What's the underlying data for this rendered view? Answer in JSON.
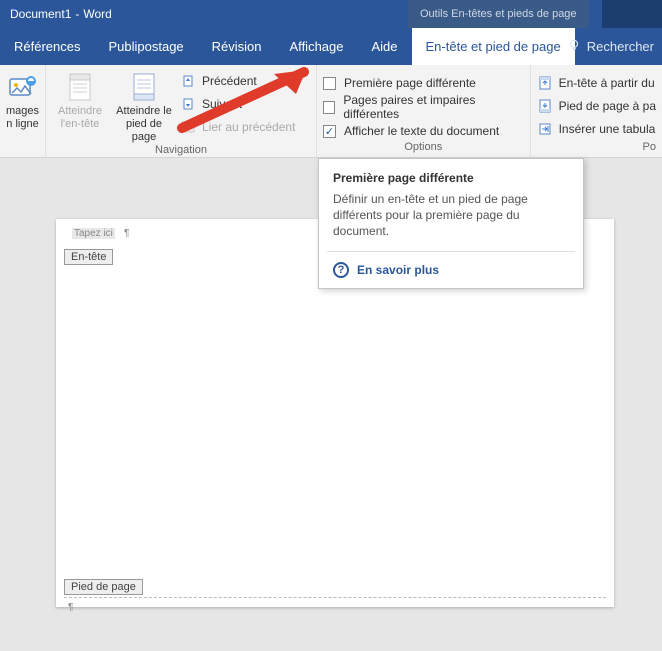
{
  "title": {
    "doc": "Document1",
    "sep": " - ",
    "app": "Word"
  },
  "context_tab": "Outils En-têtes et pieds de page",
  "tabs": {
    "references": "Références",
    "mailings": "Publipostage",
    "review": "Révision",
    "view": "Affichage",
    "help": "Aide",
    "header_footer": "En-tête et pied de page"
  },
  "search": {
    "label": "Rechercher"
  },
  "ribbon": {
    "insert": {
      "online_images": "mages\nn ligne"
    },
    "nav_group": {
      "label": "Navigation",
      "goto_header": "Atteindre\nl'en-tête",
      "goto_footer": "Atteindre le\npied de page",
      "previous": "Précédent",
      "next": "Suivant",
      "link_prev": "Lier au précédent"
    },
    "options_group": {
      "label": "Options",
      "diff_first": "Première page différente",
      "diff_odd_even": "Pages paires et impaires différentes",
      "show_doc_text": "Afficher le texte du document",
      "checked": {
        "diff_first": false,
        "diff_odd_even": false,
        "show_doc_text": true
      }
    },
    "position_group": {
      "label": "Po",
      "header_from_top": "En-tête à partir du",
      "footer_from_bottom": "Pied de page à pa",
      "insert_tab": "Insérer une tabula"
    }
  },
  "tooltip": {
    "title": "Première page différente",
    "body": "Définir un en-tête et un pied de page différents pour la première page du document.",
    "learn_more": "En savoir plus"
  },
  "page": {
    "placeholder": "Tapez ici",
    "header_tag": "En-tête",
    "footer_tag": "Pied de page"
  }
}
